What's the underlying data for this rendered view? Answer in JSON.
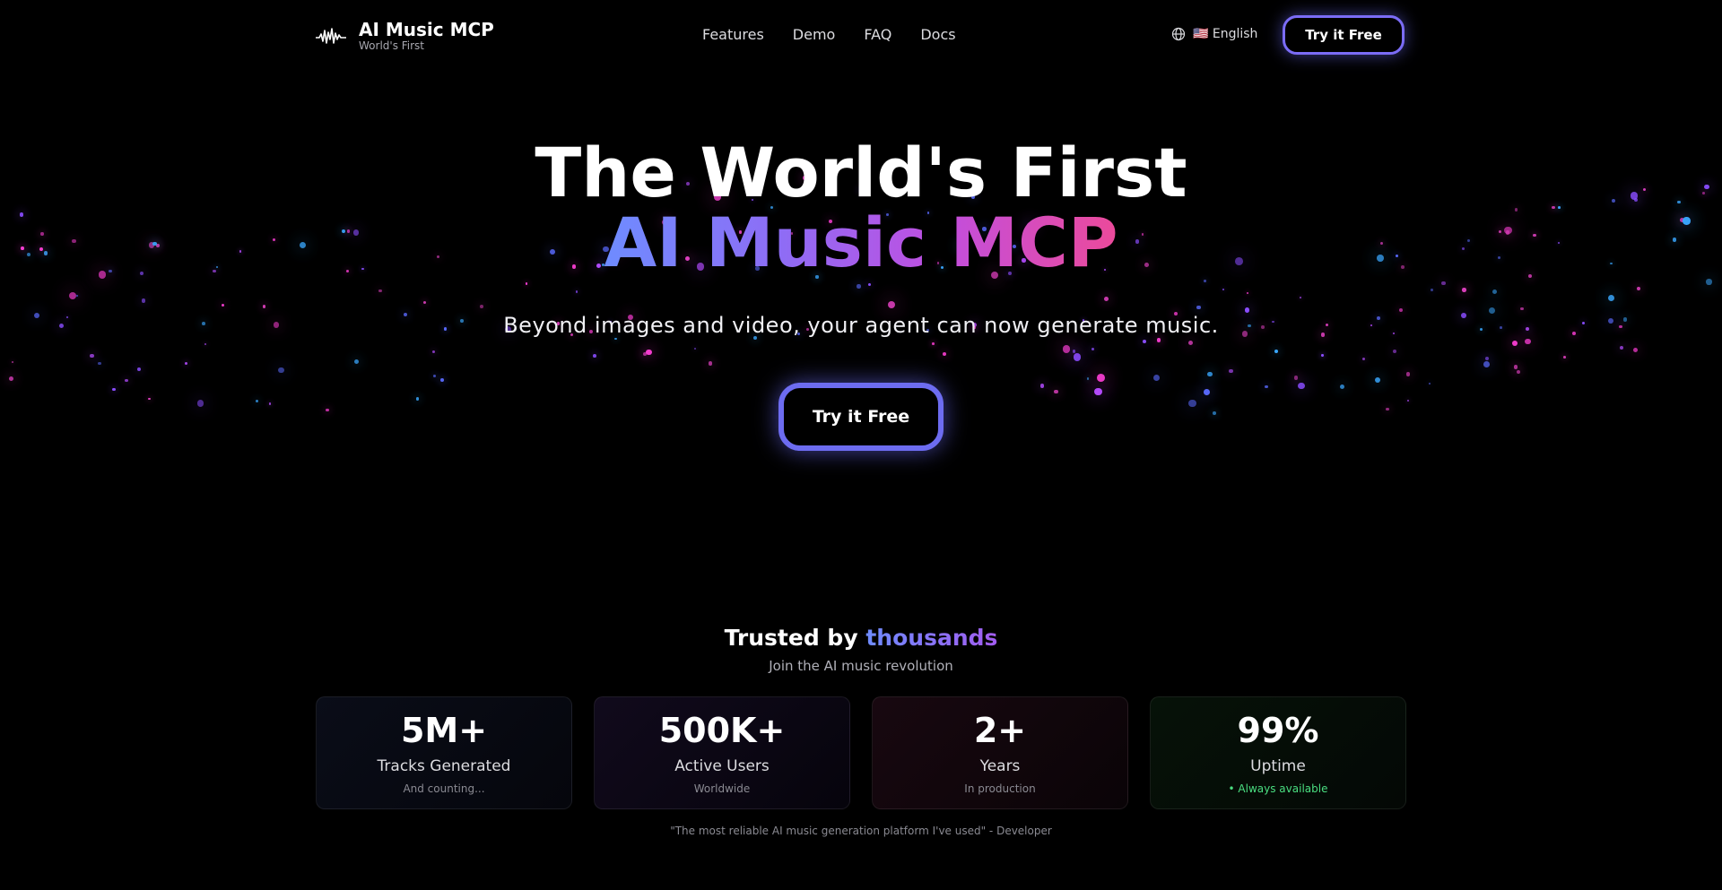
{
  "header": {
    "brand_title": "AI Music MCP",
    "brand_subtitle": "World's First",
    "nav": [
      "Features",
      "Demo",
      "FAQ",
      "Docs"
    ],
    "language": "🇺🇸 English",
    "cta": "Try it Free"
  },
  "hero": {
    "line1": "The World's First",
    "line2": "AI Music MCP",
    "subtitle": "Beyond images and video, your agent can now generate music.",
    "cta": "Try it Free"
  },
  "trusted": {
    "title_prefix": "Trusted by",
    "title_highlight": "thousands",
    "subtitle": "Join the AI music revolution",
    "stats": [
      {
        "value": "5M+",
        "label": "Tracks Generated",
        "note": "And counting..."
      },
      {
        "value": "500K+",
        "label": "Active Users",
        "note": "Worldwide"
      },
      {
        "value": "2+",
        "label": "Years",
        "note": "In production"
      },
      {
        "value": "99%",
        "label": "Uptime",
        "note": "• Always available"
      }
    ],
    "quote": "\"The most reliable AI music generation platform I've used\" - Developer"
  },
  "colors": {
    "accent_blue": "#6e8cff",
    "accent_purple": "#8f6cf5",
    "accent_pink": "#ec4a9a",
    "status_green": "#4ade80"
  },
  "icons": {
    "logo": "waveform-icon",
    "language": "globe-icon"
  }
}
